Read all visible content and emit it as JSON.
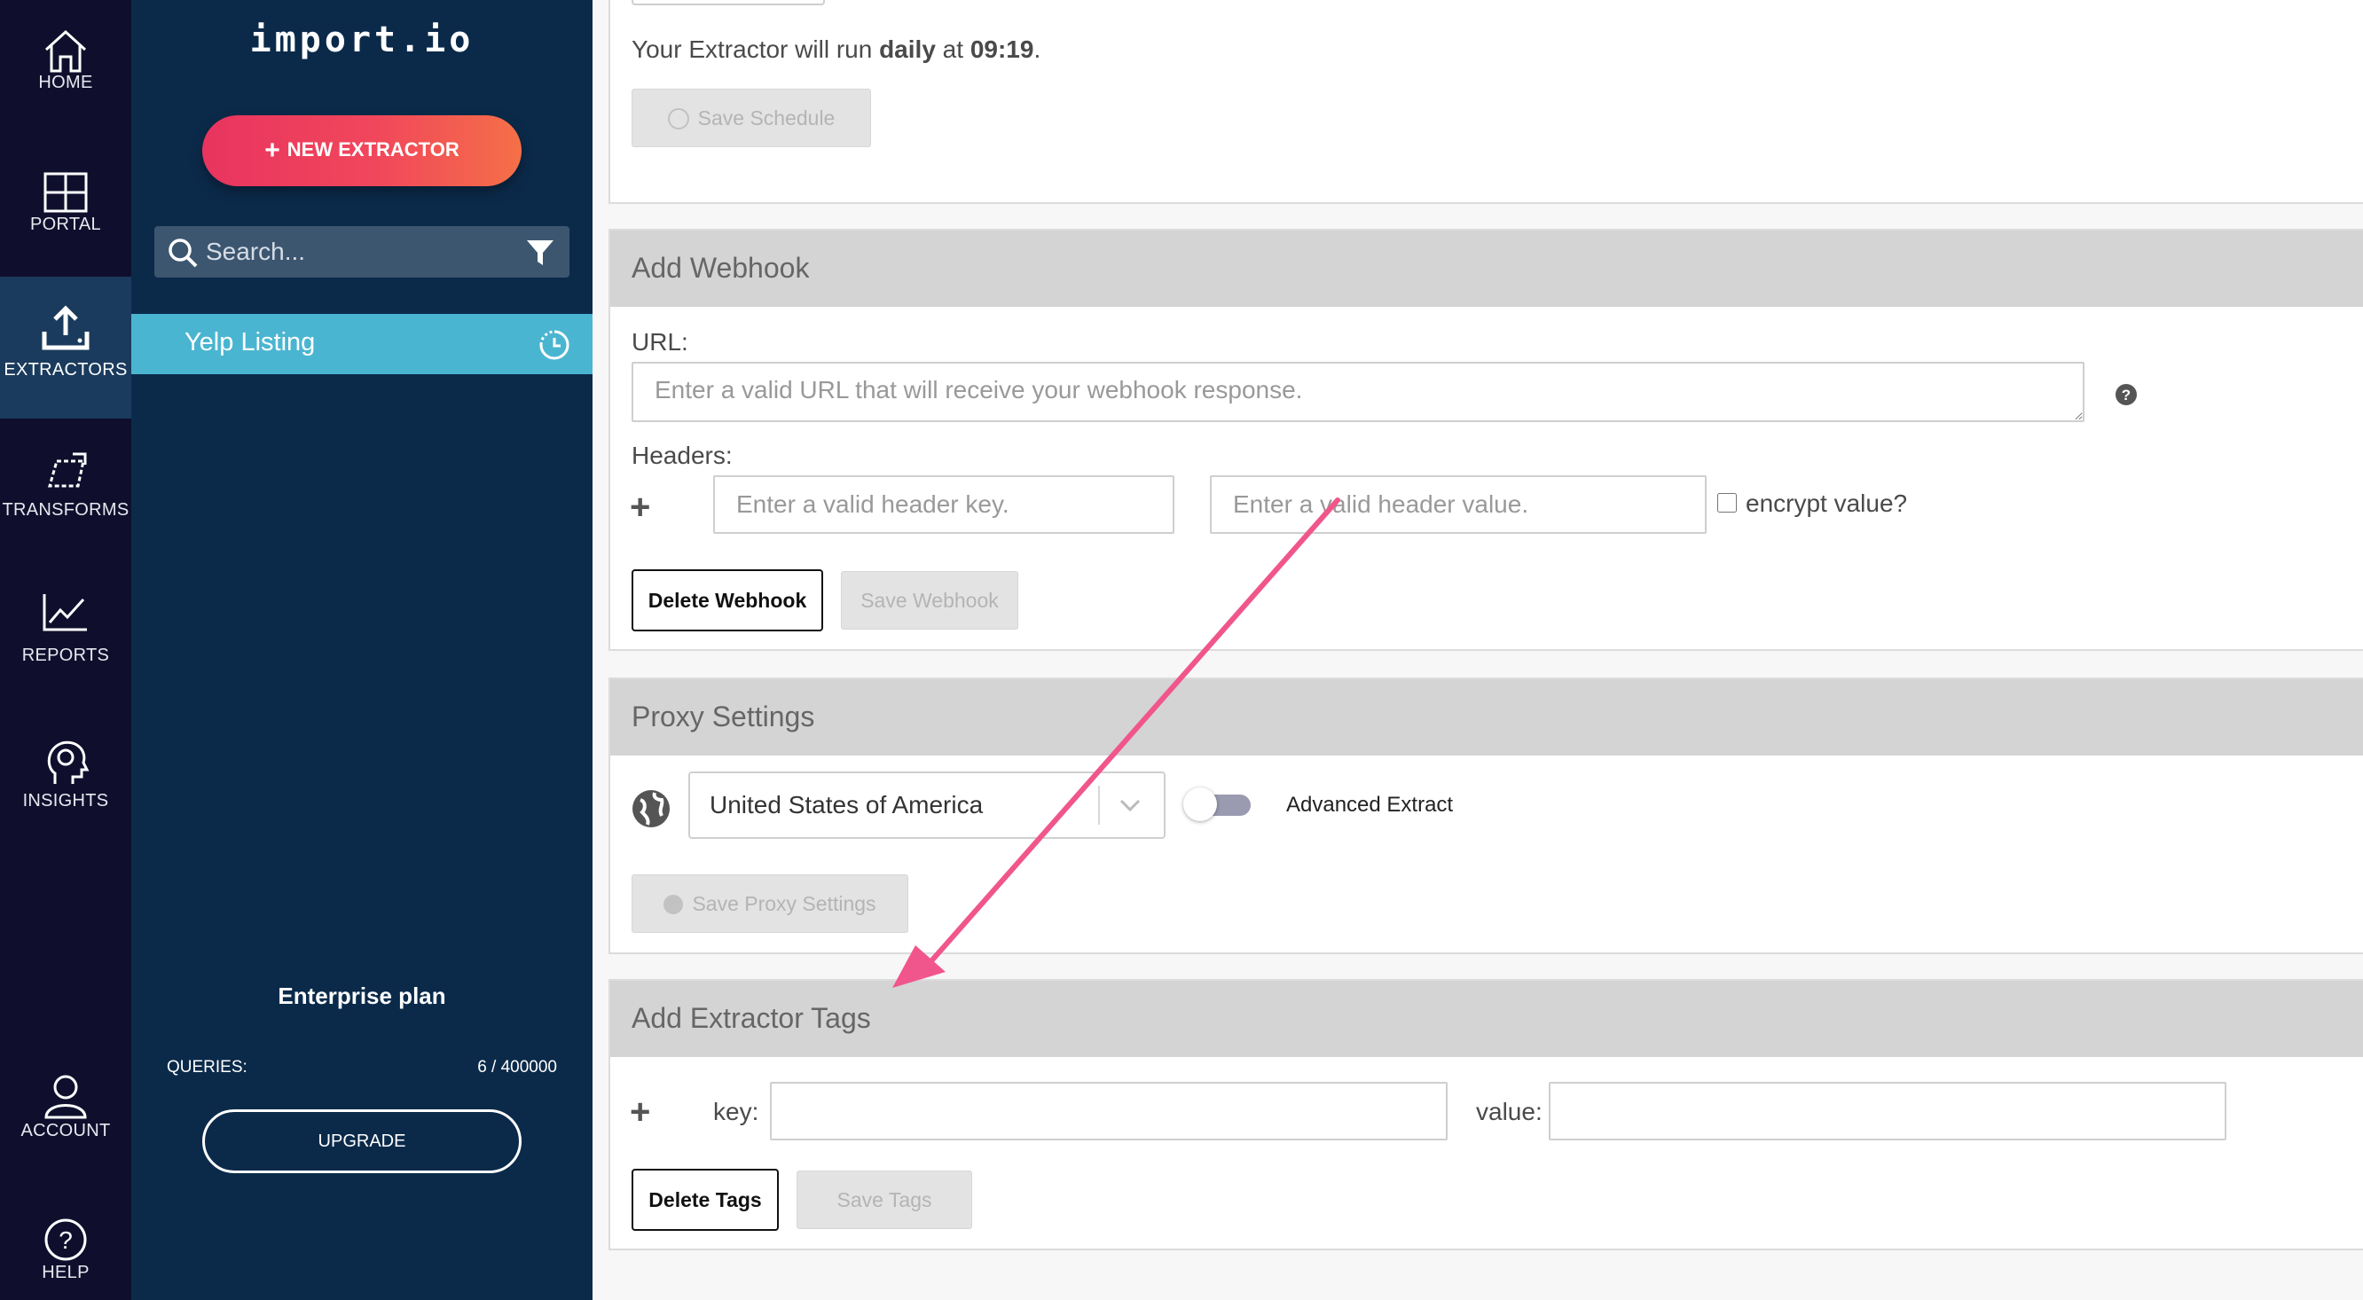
{
  "rail": {
    "items": [
      {
        "label": "HOME",
        "icon": "home-icon"
      },
      {
        "label": "PORTAL",
        "icon": "grid-icon"
      },
      {
        "label": "EXTRACTORS",
        "icon": "upload-icon"
      },
      {
        "label": "TRANSFORMS",
        "icon": "transform-icon"
      },
      {
        "label": "REPORTS",
        "icon": "chart-icon"
      },
      {
        "label": "INSIGHTS",
        "icon": "brain-icon"
      },
      {
        "label": "ACCOUNT",
        "icon": "user-icon"
      },
      {
        "label": "HELP",
        "icon": "help-icon"
      }
    ],
    "active": "EXTRACTORS"
  },
  "sidebar": {
    "logo": "import.io",
    "new_button": "NEW EXTRACTOR",
    "search_placeholder": "Search...",
    "extractors": [
      {
        "name": "Yelp Listing"
      }
    ],
    "plan": "Enterprise plan",
    "queries_label": "QUERIES:",
    "queries_value": "6 / 400000",
    "upgrade_label": "UPGRADE"
  },
  "schedule": {
    "run_prefix": "Your Extractor will run ",
    "frequency": "daily",
    "at_text": " at ",
    "time": "09:19",
    "suffix": ".",
    "save_button": "Save Schedule"
  },
  "webhook": {
    "title": "Add Webhook",
    "url_label": "URL:",
    "url_placeholder": "Enter a valid URL that will receive your webhook response.",
    "headers_label": "Headers:",
    "header_key_placeholder": "Enter a valid header key.",
    "header_value_placeholder": "Enter a valid header value.",
    "encrypt_label": "encrypt value?",
    "delete_button": "Delete Webhook",
    "save_button": "Save Webhook"
  },
  "proxy": {
    "title": "Proxy Settings",
    "country": "United States of America",
    "advanced_label": "Advanced Extract",
    "advanced_enabled": false,
    "save_button": "Save Proxy Settings"
  },
  "tags": {
    "title": "Add Extractor Tags",
    "key_label": "key:",
    "value_label": "value:",
    "delete_button": "Delete Tags",
    "save_button": "Save Tags"
  },
  "annotation": {
    "arrow_color": "#f0568c"
  }
}
